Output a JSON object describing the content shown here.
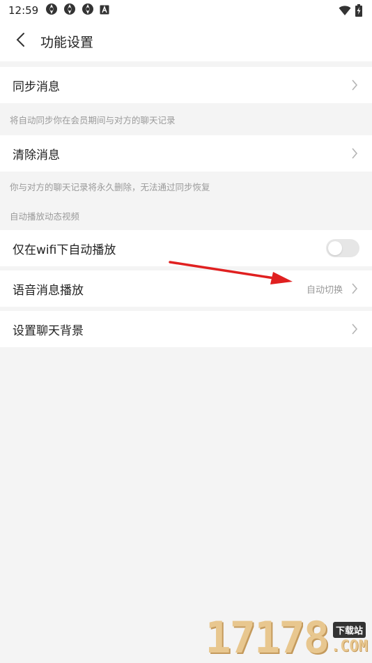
{
  "status_bar": {
    "time": "12:59",
    "notification_icons": [
      "aperture-icon",
      "aperture-icon",
      "aperture-icon",
      "letter-a-icon"
    ],
    "right_icons": [
      "wifi-icon",
      "battery-charging-icon"
    ]
  },
  "header": {
    "title": "功能设置"
  },
  "items": {
    "sync": {
      "label": "同步消息",
      "note": "将自动同步你在会员期间与对方的聊天记录"
    },
    "clear": {
      "label": "清除消息",
      "note": "你与对方的聊天记录将永久删除，无法通过同步恢复"
    },
    "video_section_title": "自动播放动态视频",
    "wifi_autoplay": {
      "label": "仅在wifi下自动播放",
      "enabled": false
    },
    "voice": {
      "label": "语音消息播放",
      "value": "自动切换"
    },
    "background": {
      "label": "设置聊天背景"
    }
  },
  "watermark": {
    "number": "17178",
    "badge": "下载站",
    "suffix": ".COM"
  },
  "colors": {
    "background": "#f4f4f4",
    "annotation_arrow": "#e02020",
    "secondary_text": "#999999"
  }
}
